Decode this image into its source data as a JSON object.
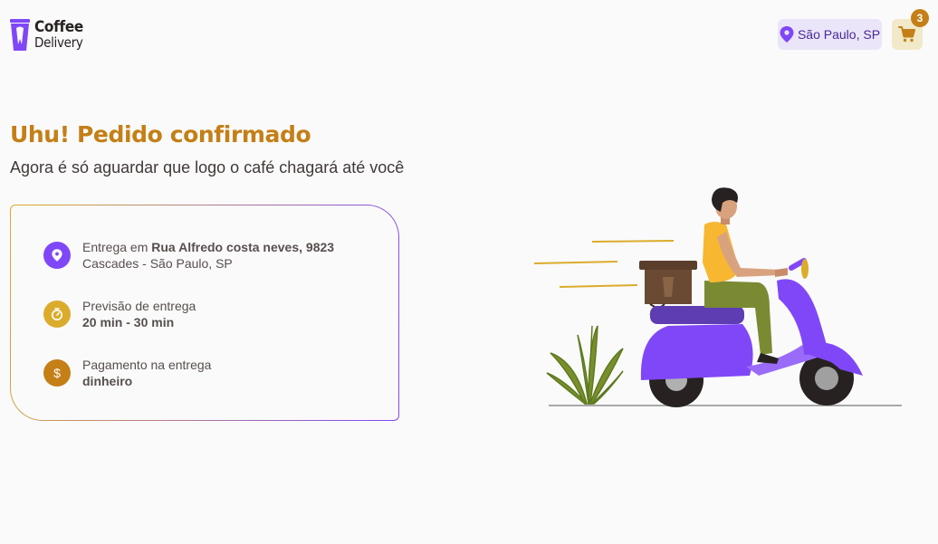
{
  "header": {
    "logo_line1": "Coffee",
    "logo_line2": "Delivery",
    "location": "São Paulo, SP",
    "cart_count": "3",
    "icons": {
      "location": "map-pin-icon",
      "cart": "shopping-cart-icon"
    }
  },
  "main": {
    "title": "Uhu! Pedido confirmado",
    "subtitle": "Agora é só aguardar que logo o café chagará até você"
  },
  "order": {
    "address_prefix": "Entrega em ",
    "address_street": "Rua Alfredo costa neves, 9823",
    "address_city": "Cascades - São Paulo, SP",
    "forecast_label": "Previsão de entrega",
    "forecast_value": "20 min - 30 min",
    "payment_label": "Pagamento na entrega",
    "payment_value": "dinheiro",
    "icons": {
      "address": "map-pin-icon",
      "forecast": "timer-icon",
      "payment": "currency-dollar-icon"
    }
  },
  "colors": {
    "brand_yellow_dark": "#C47F17",
    "brand_yellow": "#DBAC2C",
    "brand_purple": "#8047F8",
    "brand_purple_dark": "#4B2995",
    "purple_light": "#EBE5F9",
    "yellow_light": "#F1E9C9",
    "background": "#FAFAFA"
  }
}
